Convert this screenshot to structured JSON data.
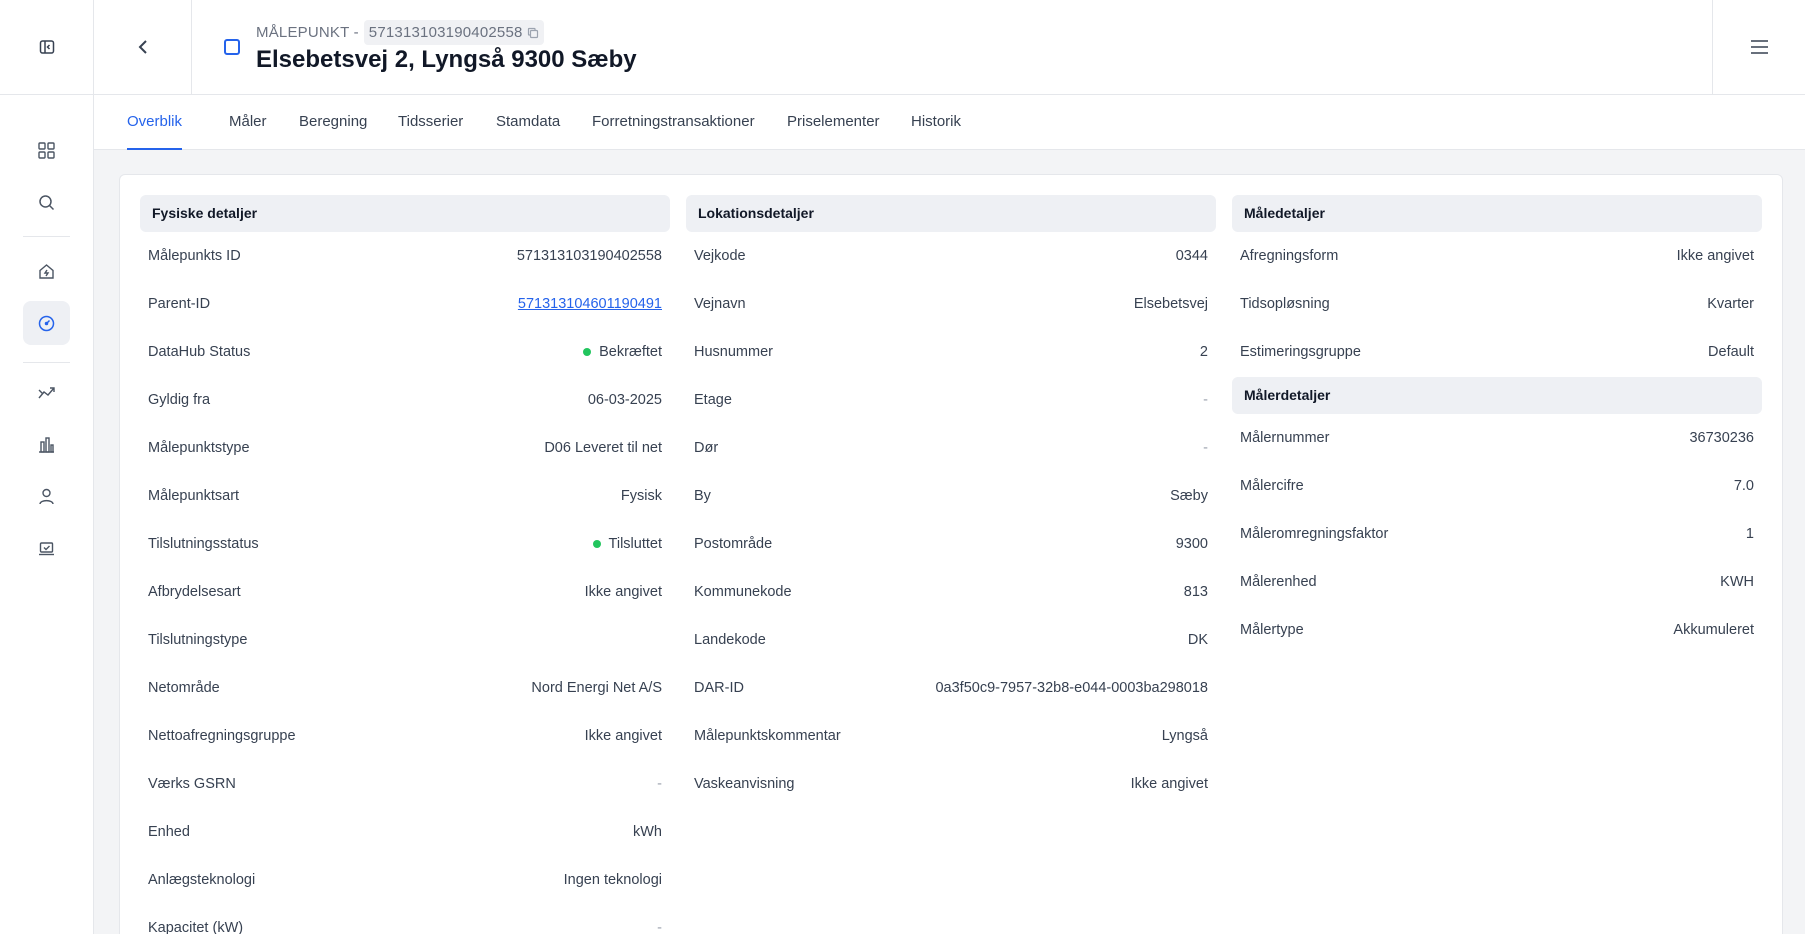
{
  "header": {
    "subtitle_prefix": "MÅLEPUNKT -",
    "id_pill": "571313103190402558",
    "title": "Elsebetsvej 2, Lyngså 9300 Sæby"
  },
  "rail": {
    "icons": [
      "sidebar-toggle-icon",
      "dashboard-grid-icon",
      "search-icon",
      "home-bolt-icon",
      "gauge-icon",
      "trend-icon",
      "bar-chart-icon",
      "user-icon",
      "laptop-check-icon"
    ]
  },
  "tabs": [
    "Overblik",
    "Måler",
    "Beregning",
    "Tidsserier",
    "Stamdata",
    "Forretningstransaktioner",
    "Priselementer",
    "Historik"
  ],
  "physical": {
    "title": "Fysiske detaljer",
    "rows": [
      {
        "label": "Målepunkts ID",
        "value": "571313103190402558"
      },
      {
        "label": "Parent-ID",
        "value": "571313104601190491"
      },
      {
        "label": "DataHub Status",
        "value": "Bekræftet"
      },
      {
        "label": "Gyldig fra",
        "value": "06-03-2025"
      },
      {
        "label": "Målepunktstype",
        "value": "D06 Leveret til net"
      },
      {
        "label": "Målepunktsart",
        "value": "Fysisk"
      },
      {
        "label": "Tilslutningsstatus",
        "value": "Tilsluttet"
      },
      {
        "label": "Afbrydelsesart",
        "value": "Ikke angivet"
      },
      {
        "label": "Tilslutningstype",
        "value": ""
      },
      {
        "label": "Netområde",
        "value": "Nord Energi Net A/S"
      },
      {
        "label": "Nettoafregningsgruppe",
        "value": "Ikke angivet"
      },
      {
        "label": "Værks GSRN",
        "value": "-"
      },
      {
        "label": "Enhed",
        "value": "kWh"
      },
      {
        "label": "Anlægsteknologi",
        "value": "Ingen teknologi"
      },
      {
        "label": "Kapacitet (kW)",
        "value": "-"
      }
    ]
  },
  "location": {
    "title": "Lokationsdetaljer",
    "rows": [
      {
        "label": "Vejkode",
        "value": "0344"
      },
      {
        "label": "Vejnavn",
        "value": "Elsebetsvej"
      },
      {
        "label": "Husnummer",
        "value": "2"
      },
      {
        "label": "Etage",
        "value": "-"
      },
      {
        "label": "Dør",
        "value": "-"
      },
      {
        "label": "By",
        "value": "Sæby"
      },
      {
        "label": "Postområde",
        "value": "9300"
      },
      {
        "label": "Kommunekode",
        "value": "813"
      },
      {
        "label": "Landekode",
        "value": "DK"
      },
      {
        "label": "DAR-ID",
        "value": "0a3f50c9-7957-32b8-e044-0003ba298018"
      },
      {
        "label": "Målepunktskommentar",
        "value": "Lyngså"
      },
      {
        "label": "Vaskeanvisning",
        "value": "Ikke angivet"
      }
    ]
  },
  "measure": {
    "title": "Måledetaljer",
    "rows": [
      {
        "label": "Afregningsform",
        "value": "Ikke angivet"
      },
      {
        "label": "Tidsopløsning",
        "value": "Kvarter"
      },
      {
        "label": "Estimeringsgruppe",
        "value": "Default"
      }
    ]
  },
  "meter": {
    "title": "Målerdetaljer",
    "rows": [
      {
        "label": "Målernummer",
        "value": "36730236"
      },
      {
        "label": "Målercifre",
        "value": "7.0"
      },
      {
        "label": "Måleromregningsfaktor",
        "value": "1"
      },
      {
        "label": "Målerenhed",
        "value": "KWH"
      },
      {
        "label": "Målertype",
        "value": "Akkumuleret"
      }
    ]
  },
  "colors": {
    "accent": "#2563eb",
    "status_ok": "#22c55e"
  }
}
